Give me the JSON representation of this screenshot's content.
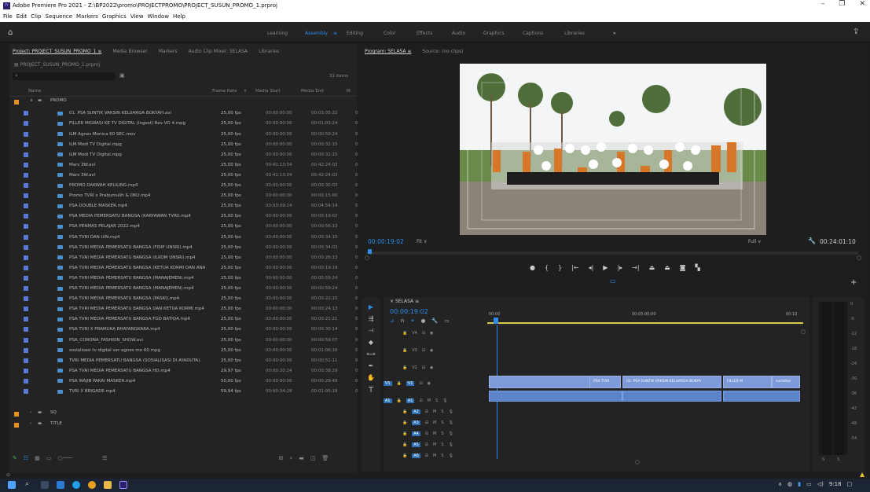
{
  "window": {
    "title": "Adobe Premiere Pro 2021 - Z:\\BP2022\\promo\\PROJECTPROMO\\PROJECT_SUSUN_PROMO_1.prproj",
    "app_icon": "Pr"
  },
  "menu": [
    "File",
    "Edit",
    "Clip",
    "Sequence",
    "Markers",
    "Graphics",
    "View",
    "Window",
    "Help"
  ],
  "workspaces": {
    "items": [
      "Learning",
      "Assembly",
      "Editing",
      "Color",
      "Effects",
      "Audio",
      "Graphics",
      "Captions",
      "Libraries"
    ],
    "active": "Assembly",
    "more": "»"
  },
  "project_panel": {
    "tabs": [
      "Project: PROJECT_SUSUN_PROMO_1",
      "Media Browser",
      "Markers",
      "Audio Clip Mixer: SELASA",
      "Libraries"
    ],
    "breadcrumb": "PROJECT_SUSUN_PROMO_1.prproj",
    "item_count": "31 items",
    "columns": {
      "name": "Name",
      "frame_rate": "Frame Rate",
      "media_start": "Media Start",
      "media_end": "Media End",
      "extra": "M"
    },
    "root_bin": "PROMO",
    "items": [
      {
        "name": "01. PSA SUNTIK VAKSIN KELUARGA BOKYAH.avi",
        "fr": "25,00 fps",
        "ms": "00:00:00:00",
        "me": "00:03:05:22",
        "c": "0"
      },
      {
        "name": "FILLER MIGRASI KE TV DIGITAL (Ingest) Rev VO 4.mpg",
        "fr": "25,00 fps",
        "ms": "00:00:00:00",
        "me": "00:01:03:24",
        "c": "0"
      },
      {
        "name": "ILM Agnes Monica 60 SEC.mov",
        "fr": "25,00 fps",
        "ms": "00:00:00:00",
        "me": "00:00:59:24",
        "c": "0"
      },
      {
        "name": "ILM Modi TV Digital.mpg",
        "fr": "25,00 fps",
        "ms": "00:00:00:00",
        "me": "00:00:32:15",
        "c": "0"
      },
      {
        "name": "ILM Modi TV Digital.mpg",
        "fr": "25,00 fps",
        "ms": "00:00:00:00",
        "me": "00:00:32:15",
        "c": "0"
      },
      {
        "name": "Mars 3W.avi",
        "fr": "25,00 fps",
        "ms": "00:41:13:04",
        "me": "00:42:24:03",
        "c": "0"
      },
      {
        "name": "Mars 3W.avi",
        "fr": "25,00 fps",
        "ms": "00:41:13:04",
        "me": "00:42:24:03",
        "c": "0"
      },
      {
        "name": "PROMO DAKWAH KELILING.mp4",
        "fr": "25,00 fps",
        "ms": "00:00:00:00",
        "me": "00:00:30:03",
        "c": "0"
      },
      {
        "name": "Promo TVRI x Prabumulih & OKU.mp4",
        "fr": "25,00 fps",
        "ms": "00:00:00:00",
        "me": "00:00:15:00",
        "c": "0"
      },
      {
        "name": "PSA DOUBLE MASKER.mp4",
        "fr": "25,00 fps",
        "ms": "00:03:09:14",
        "me": "00:04:54:14",
        "c": "0"
      },
      {
        "name": "PSA MEDIA PEMERSATU BANGSA (KARYAWAN TVRI).mp4",
        "fr": "25,00 fps",
        "ms": "00:00:00:00",
        "me": "00:00:19:02",
        "c": "0"
      },
      {
        "name": "PSA PENMAS PELAJAR 2022.mp4",
        "fr": "25,00 fps",
        "ms": "00:00:00:00",
        "me": "00:00:56:13",
        "c": "0"
      },
      {
        "name": "PSA TVRI DAN UIN.mp4",
        "fr": "25,00 fps",
        "ms": "00:00:00:00",
        "me": "00:00:34:15",
        "c": "0"
      },
      {
        "name": "PSA TVRI MEDIA PEMERSATU BANGSA (FISIP UNSRI).mp4",
        "fr": "25,00 fps",
        "ms": "00:00:00:00",
        "me": "00:00:34:03",
        "c": "0"
      },
      {
        "name": "PSA TVRI MEDIA PEMERSATU BANGSA (ILKOM UNSRI).mp4",
        "fr": "25,00 fps",
        "ms": "00:00:00:00",
        "me": "00:00:26:13",
        "c": "0"
      },
      {
        "name": "PSA TVRI MEDIA PEMERSATU BANGSA (KETUA KORMI DAN ANA",
        "fr": "25,00 fps",
        "ms": "00:00:00:00",
        "me": "00:00:19:19",
        "c": "0"
      },
      {
        "name": "PSA TVRI MEDIA PEMERSATU BANGSA (MANAJEMEN).mp4",
        "fr": "25,00 fps",
        "ms": "00:00:00:00",
        "me": "00:00:59:24",
        "c": "0"
      },
      {
        "name": "PSA TVRI MEDIA PEMERSATU BANGSA (MANAJEMEN).mp4",
        "fr": "25,00 fps",
        "ms": "00:00:00:00",
        "me": "00:00:59:24",
        "c": "0"
      },
      {
        "name": "PSA TVRI MEDIA PEMERSATU BANGSA (PASKI).mp4",
        "fr": "25,00 fps",
        "ms": "00:00:00:00",
        "me": "00:00:22:15",
        "c": "0"
      },
      {
        "name": "PSA TVRI MEDIA PEMERSATU BANGSA DAN KETUA KORMI.mp4",
        "fr": "25,00 fps",
        "ms": "00:00:00:00",
        "me": "00:00:24:13",
        "c": "0"
      },
      {
        "name": "PSA TVRI MEDIA PEMERSATU BANGSA FGD BATIQA.mp4",
        "fr": "25,00 fps",
        "ms": "00:00:00:00",
        "me": "00:00:21:21",
        "c": "0"
      },
      {
        "name": "PSA TVRI X PRAMUKA BHAYANGKARA.mp4",
        "fr": "25,00 fps",
        "ms": "00:00:00:00",
        "me": "00:00:30:14",
        "c": "0"
      },
      {
        "name": "PSA_CORONA_FASHION_SHOW.avi",
        "fr": "25,00 fps",
        "ms": "00:00:00:00",
        "me": "00:00:59:07",
        "c": "0"
      },
      {
        "name": "sosialisasi tv digital ver agnes mo 60.mpg",
        "fr": "25,00 fps",
        "ms": "00:00:00:00",
        "me": "00:01:06:16",
        "c": "0"
      },
      {
        "name": "TVRI MEDIA PEMERSATU BANGSA (SOSIALISASI DI AYADUTA).",
        "fr": "25,00 fps",
        "ms": "00:00:00:00",
        "me": "00:00:51:11",
        "c": "0"
      },
      {
        "name": "PSA TVRI MEDIA PEMERSATU BANGSA HD.mp4",
        "fr": "29,97 fps",
        "ms": "00:00:20:24",
        "me": "00:00:38:29",
        "c": "0"
      },
      {
        "name": "PSA WAJIB PAKAI MASKER.mp4",
        "fr": "50,00 fps",
        "ms": "00:00:00:00",
        "me": "00:00:29:49",
        "c": "0"
      },
      {
        "name": "TVRI X BRIGADE.mp4",
        "fr": "59,94 fps",
        "ms": "00:00:34:28",
        "me": "00:01:05:19",
        "c": "0"
      }
    ],
    "sub_bins": [
      "SQ",
      "TITLE"
    ]
  },
  "program_monitor": {
    "tabs": [
      "Program: SELASA",
      "Source: (no clips)"
    ],
    "timecode": "00:00:19:02",
    "fit": "Fit",
    "quality": "Full",
    "duration": "00:24:01:10"
  },
  "timeline": {
    "sequence": "SELASA",
    "timecode": "00:00:19:02",
    "ruler": [
      "00:00",
      "00:05:00:00",
      "00:10"
    ],
    "video_tracks": [
      "V4",
      "V3",
      "V2",
      "V1"
    ],
    "audio_tracks": [
      "A1",
      "A2",
      "A3",
      "A4",
      "A5",
      "A6"
    ],
    "clips": [
      {
        "label": "PSA TVRI"
      },
      {
        "label": "01. PSA SUNTIK VAKSIN KELUARGA BOKYA"
      },
      {
        "label": "FILLER M"
      },
      {
        "label": "sosialisa"
      }
    ],
    "meter_scale": [
      "0",
      "-6",
      "-12",
      "-18",
      "-24",
      "-30",
      "-36",
      "-42",
      "-48",
      "-54"
    ],
    "meter_footer": [
      "S",
      "S"
    ]
  },
  "taskbar": {
    "time": "9:18"
  }
}
